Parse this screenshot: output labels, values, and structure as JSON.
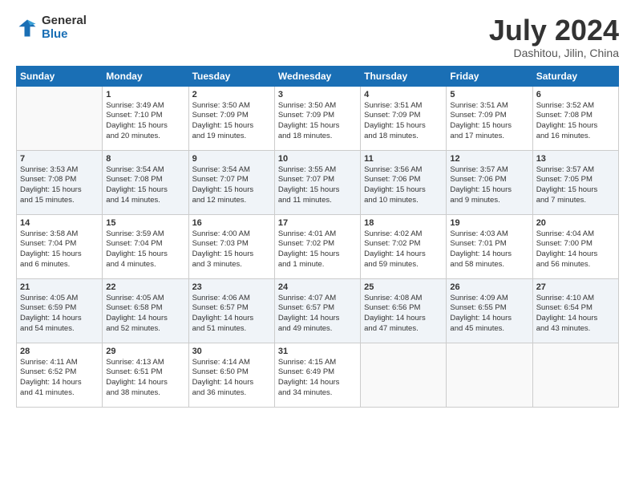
{
  "header": {
    "logo_general": "General",
    "logo_blue": "Blue",
    "title": "July 2024",
    "location": "Dashitou, Jilin, China"
  },
  "days_of_week": [
    "Sunday",
    "Monday",
    "Tuesday",
    "Wednesday",
    "Thursday",
    "Friday",
    "Saturday"
  ],
  "weeks": [
    [
      {
        "day": "",
        "content": ""
      },
      {
        "day": "1",
        "content": "Sunrise: 3:49 AM\nSunset: 7:10 PM\nDaylight: 15 hours\nand 20 minutes."
      },
      {
        "day": "2",
        "content": "Sunrise: 3:50 AM\nSunset: 7:09 PM\nDaylight: 15 hours\nand 19 minutes."
      },
      {
        "day": "3",
        "content": "Sunrise: 3:50 AM\nSunset: 7:09 PM\nDaylight: 15 hours\nand 18 minutes."
      },
      {
        "day": "4",
        "content": "Sunrise: 3:51 AM\nSunset: 7:09 PM\nDaylight: 15 hours\nand 18 minutes."
      },
      {
        "day": "5",
        "content": "Sunrise: 3:51 AM\nSunset: 7:09 PM\nDaylight: 15 hours\nand 17 minutes."
      },
      {
        "day": "6",
        "content": "Sunrise: 3:52 AM\nSunset: 7:08 PM\nDaylight: 15 hours\nand 16 minutes."
      }
    ],
    [
      {
        "day": "7",
        "content": "Sunrise: 3:53 AM\nSunset: 7:08 PM\nDaylight: 15 hours\nand 15 minutes."
      },
      {
        "day": "8",
        "content": "Sunrise: 3:54 AM\nSunset: 7:08 PM\nDaylight: 15 hours\nand 14 minutes."
      },
      {
        "day": "9",
        "content": "Sunrise: 3:54 AM\nSunset: 7:07 PM\nDaylight: 15 hours\nand 12 minutes."
      },
      {
        "day": "10",
        "content": "Sunrise: 3:55 AM\nSunset: 7:07 PM\nDaylight: 15 hours\nand 11 minutes."
      },
      {
        "day": "11",
        "content": "Sunrise: 3:56 AM\nSunset: 7:06 PM\nDaylight: 15 hours\nand 10 minutes."
      },
      {
        "day": "12",
        "content": "Sunrise: 3:57 AM\nSunset: 7:06 PM\nDaylight: 15 hours\nand 9 minutes."
      },
      {
        "day": "13",
        "content": "Sunrise: 3:57 AM\nSunset: 7:05 PM\nDaylight: 15 hours\nand 7 minutes."
      }
    ],
    [
      {
        "day": "14",
        "content": "Sunrise: 3:58 AM\nSunset: 7:04 PM\nDaylight: 15 hours\nand 6 minutes."
      },
      {
        "day": "15",
        "content": "Sunrise: 3:59 AM\nSunset: 7:04 PM\nDaylight: 15 hours\nand 4 minutes."
      },
      {
        "day": "16",
        "content": "Sunrise: 4:00 AM\nSunset: 7:03 PM\nDaylight: 15 hours\nand 3 minutes."
      },
      {
        "day": "17",
        "content": "Sunrise: 4:01 AM\nSunset: 7:02 PM\nDaylight: 15 hours\nand 1 minute."
      },
      {
        "day": "18",
        "content": "Sunrise: 4:02 AM\nSunset: 7:02 PM\nDaylight: 14 hours\nand 59 minutes."
      },
      {
        "day": "19",
        "content": "Sunrise: 4:03 AM\nSunset: 7:01 PM\nDaylight: 14 hours\nand 58 minutes."
      },
      {
        "day": "20",
        "content": "Sunrise: 4:04 AM\nSunset: 7:00 PM\nDaylight: 14 hours\nand 56 minutes."
      }
    ],
    [
      {
        "day": "21",
        "content": "Sunrise: 4:05 AM\nSunset: 6:59 PM\nDaylight: 14 hours\nand 54 minutes."
      },
      {
        "day": "22",
        "content": "Sunrise: 4:05 AM\nSunset: 6:58 PM\nDaylight: 14 hours\nand 52 minutes."
      },
      {
        "day": "23",
        "content": "Sunrise: 4:06 AM\nSunset: 6:57 PM\nDaylight: 14 hours\nand 51 minutes."
      },
      {
        "day": "24",
        "content": "Sunrise: 4:07 AM\nSunset: 6:57 PM\nDaylight: 14 hours\nand 49 minutes."
      },
      {
        "day": "25",
        "content": "Sunrise: 4:08 AM\nSunset: 6:56 PM\nDaylight: 14 hours\nand 47 minutes."
      },
      {
        "day": "26",
        "content": "Sunrise: 4:09 AM\nSunset: 6:55 PM\nDaylight: 14 hours\nand 45 minutes."
      },
      {
        "day": "27",
        "content": "Sunrise: 4:10 AM\nSunset: 6:54 PM\nDaylight: 14 hours\nand 43 minutes."
      }
    ],
    [
      {
        "day": "28",
        "content": "Sunrise: 4:11 AM\nSunset: 6:52 PM\nDaylight: 14 hours\nand 41 minutes."
      },
      {
        "day": "29",
        "content": "Sunrise: 4:13 AM\nSunset: 6:51 PM\nDaylight: 14 hours\nand 38 minutes."
      },
      {
        "day": "30",
        "content": "Sunrise: 4:14 AM\nSunset: 6:50 PM\nDaylight: 14 hours\nand 36 minutes."
      },
      {
        "day": "31",
        "content": "Sunrise: 4:15 AM\nSunset: 6:49 PM\nDaylight: 14 hours\nand 34 minutes."
      },
      {
        "day": "",
        "content": ""
      },
      {
        "day": "",
        "content": ""
      },
      {
        "day": "",
        "content": ""
      }
    ]
  ]
}
